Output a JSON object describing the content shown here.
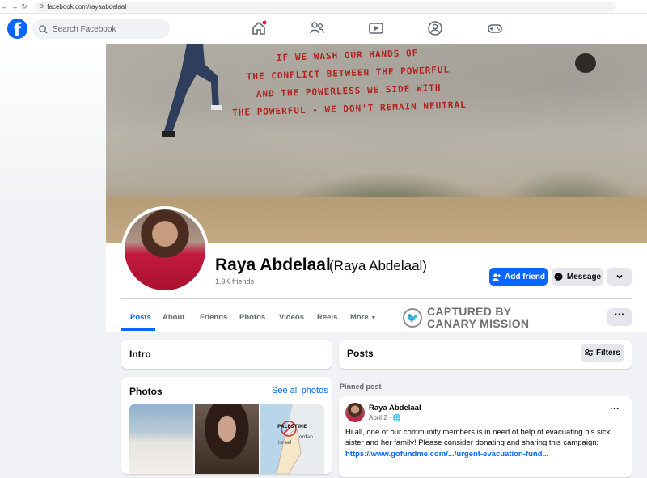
{
  "browser": {
    "url": "facebook.com/rayaabdelaal"
  },
  "topbar": {
    "logo": "f",
    "search_placeholder": "Search Facebook"
  },
  "cover": {
    "graffiti_lines": [
      "IF WE WASH OUR HANDS OF",
      "THE CONFLICT BETWEEN THE POWERFUL",
      "AND THE POWERLESS WE SIDE WITH",
      "THE POWERFUL - WE DON'T REMAIN NEUTRAL"
    ]
  },
  "profile": {
    "name": "Raya Abdelaal",
    "alt_name": "(Raya Abdelaal)",
    "friends": "1.9K friends"
  },
  "actions": {
    "add_friend": "Add friend",
    "message": "Message"
  },
  "tabs": [
    "Posts",
    "About",
    "Friends",
    "Photos",
    "Videos",
    "Reels",
    "More"
  ],
  "watermark": {
    "line1": "CAPTURED BY",
    "line2": "CANARY MISSION"
  },
  "intro": {
    "title": "Intro"
  },
  "photos": {
    "title": "Photos",
    "see_all": "See all photos",
    "map_labels": [
      "PALESTINE",
      "Jordan",
      "Israel"
    ]
  },
  "posts": {
    "title": "Posts",
    "filters": "Filters",
    "pinned_label": "Pinned post"
  },
  "post": {
    "author": "Raya Abdelaal",
    "date": "April 2 · ",
    "text": "Hi all, one of our community members is in need of help of evacuating his sick sister and her family! Please consider donating and sharing this campaign:",
    "link": "https://www.gofundme.com/.../urgent-evacuation-fund..."
  },
  "colors": {
    "brand": "#0866ff",
    "notification": "#e41e3f",
    "graffiti": "#b0231f"
  }
}
